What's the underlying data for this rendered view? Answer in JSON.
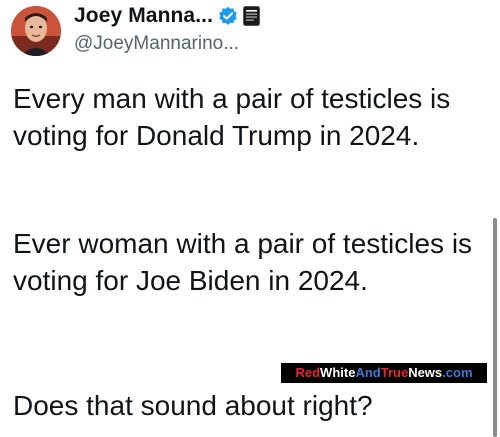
{
  "author": {
    "display_name": "Joey Manna...",
    "handle": "@JoeyMannarino..."
  },
  "icons": {
    "verified": "verified-badge-icon",
    "affiliate": "affiliate-badge-icon"
  },
  "tweet": {
    "paragraph_1": "Every man with a pair of testicles is voting for Donald Trump in 2024.",
    "paragraph_2": "Ever woman with a pair of testicles is voting for Joe Biden in 2024.",
    "paragraph_3": "Does that sound about right?"
  },
  "watermark": {
    "part_red": "Red",
    "part_white_1": "White",
    "part_blue_1": "And",
    "part_red_2": "True",
    "part_white_2": "News",
    "part_blue_2": ".com"
  },
  "colors": {
    "verified_blue": "#1d9bf0",
    "text": "#0f1419",
    "handle_gray": "#536471"
  }
}
